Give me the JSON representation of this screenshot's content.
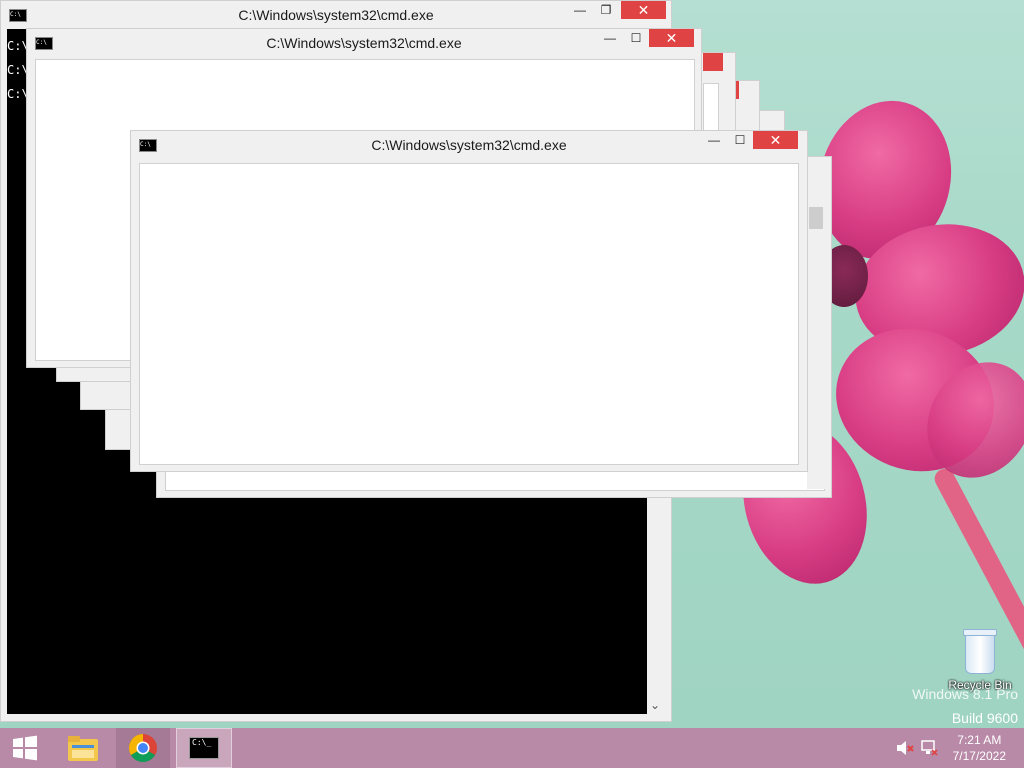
{
  "windows": {
    "title": "C:\\Windows\\system32\\cmd.exe",
    "prompt": "C:\\",
    "controls": {
      "minimize": "—",
      "maximize": "☐",
      "restore": "❐",
      "close": "✕"
    },
    "scroll_down_icon": "chevron-down-icon"
  },
  "desktop": {
    "recycle_bin_label": "Recycle Bin",
    "watermark_line1": "Windows 8.1 Pro",
    "watermark_line2": "Build 9600"
  },
  "taskbar": {
    "time": "7:21 AM",
    "date": "7/17/2022",
    "apps": [
      "file-explorer",
      "google-chrome",
      "command-prompt"
    ]
  },
  "colors": {
    "close_red": "#e04343",
    "taskbar": "#b88aa7",
    "desktop_bg": "#a6d8c7",
    "flower_pink": "#d83d84"
  }
}
